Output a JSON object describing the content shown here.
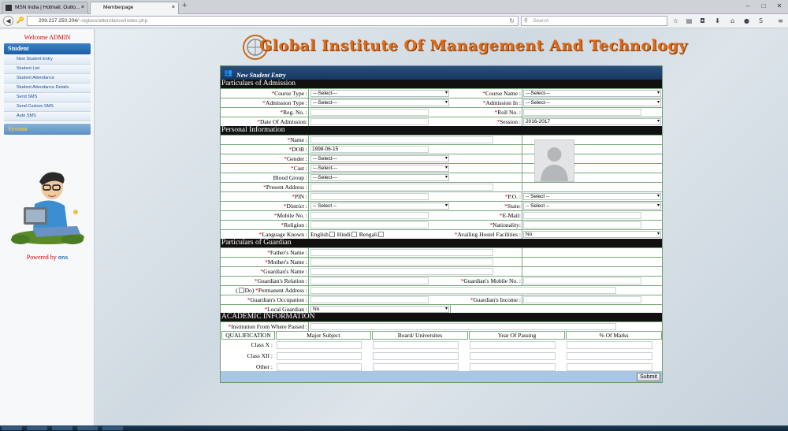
{
  "browser": {
    "tabs": [
      {
        "label": "MSN India | Hotmail, Outlo..."
      },
      {
        "label": "Memberpage"
      }
    ],
    "url_host": "209.217.250.204/",
    "url_path": "~siglass/attendance/index.php",
    "search_placeholder": "Search"
  },
  "sidebar": {
    "welcome": "Welcome ADMIN",
    "section_student": "Student",
    "items": [
      {
        "label": "New Student Entry"
      },
      {
        "label": "Student List"
      },
      {
        "label": "Student Attendance"
      },
      {
        "label": "Student Attendance Details"
      },
      {
        "label": "Send SMS"
      },
      {
        "label": "Send Custom SMS"
      },
      {
        "label": "Auto SMS"
      }
    ],
    "section_system": "System",
    "powered_by": "Powered by",
    "powered_brand": "ons"
  },
  "header": {
    "title": "Global Institute Of Management And Technology"
  },
  "form": {
    "title": "New Student Entry",
    "sections": {
      "admission": "Particulars of Admission",
      "personal": "Personal Information",
      "guardian": "Particulars of Guardian",
      "academic": "ACADEMIC INFORMATION"
    },
    "labels": {
      "course_type": "Course Type :",
      "course_name": "Course Name :",
      "admission_type": "Admission Type :",
      "admission_in": "Admission In :",
      "reg_no": "Reg. No. :",
      "roll_no": "Roll No. :",
      "date_of_admission": "Date Of Admission:",
      "session": "Session :",
      "name": "Name :",
      "dob": "DOB :",
      "gender": "Gender :",
      "cast": "Cast :",
      "blood_group": "Blood Group :",
      "present_address": "Present Address :",
      "pin": "PIN :",
      "po": "P.O. :",
      "district": "District :",
      "state": "State:",
      "mobile": "Mobile No. :",
      "email": "E-Mail:",
      "religion": "Religion :",
      "nationality": "Nationality:",
      "language_known": "Language Known :",
      "hostel": "Availing Hostel Facilities :",
      "fathers_name": "Father's Name :",
      "mothers_name": "Mother's Name :",
      "guardians_name": "Guardian's Name :",
      "guardians_relation": "Guardian's Relation :",
      "guardians_mobile": "Guardian's Mobile No. :",
      "permanent_address": "Permanent Address :",
      "do_prefix": "(",
      "do_label": "Do)",
      "guardians_occupation": "Guardian's Occupation :",
      "guardians_income": "Guardian's Income :",
      "local_guardian": "Local Guardian :",
      "institution": "Institution From Where Passed :"
    },
    "values": {
      "course_type": "---Select---",
      "course_name": "---Select---",
      "admission_type": "---Select---",
      "admission_in": "---Select---",
      "session": "2016-2017",
      "dob": "1998-06-15",
      "gender": "---Select---",
      "cast": "---Select---",
      "blood_group": "---Select---",
      "po": "-- Select --",
      "district": "-- Select --",
      "state": "-- Select --",
      "hostel": "No",
      "local_guardian": "No"
    },
    "languages": [
      "English",
      "Hindi",
      "Bengali"
    ],
    "academic_table": {
      "headers": [
        "QUALIFICATION",
        "Major Subject",
        "Board/ Universites",
        "Year Of Passing",
        "% Of Marks"
      ],
      "rows": [
        {
          "label": "Class X :"
        },
        {
          "label": "Class XII :"
        },
        {
          "label": "Other :"
        }
      ]
    },
    "submit_label": "Submit"
  }
}
